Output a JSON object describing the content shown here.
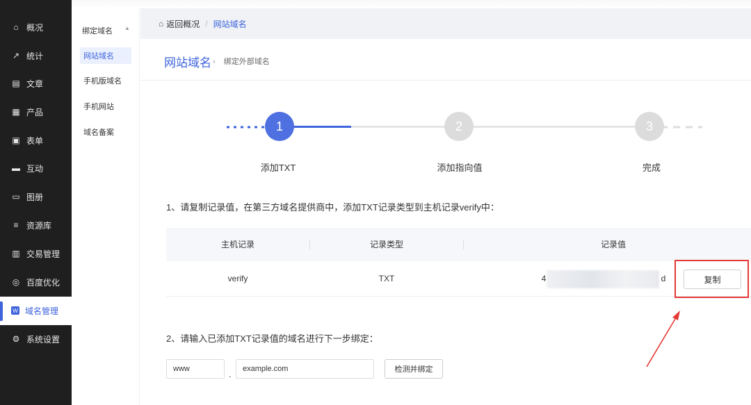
{
  "sidebar": {
    "items": [
      {
        "label": "概况",
        "icon": "home-icon",
        "glyph": "⌂"
      },
      {
        "label": "统计",
        "icon": "stats-icon",
        "glyph": "↗"
      },
      {
        "label": "文章",
        "icon": "article-icon",
        "glyph": "▤"
      },
      {
        "label": "产品",
        "icon": "product-icon",
        "glyph": "▦"
      },
      {
        "label": "表单",
        "icon": "form-icon",
        "glyph": "▣"
      },
      {
        "label": "互动",
        "icon": "chat-icon",
        "glyph": "▬"
      },
      {
        "label": "图册",
        "icon": "album-icon",
        "glyph": "▭"
      },
      {
        "label": "资源库",
        "icon": "database-icon",
        "glyph": "≡"
      },
      {
        "label": "交易管理",
        "icon": "trade-icon",
        "glyph": "▥"
      },
      {
        "label": "百度优化",
        "icon": "seo-icon",
        "glyph": "◎"
      },
      {
        "label": "域名管理",
        "icon": "domain-icon",
        "glyph": "W"
      },
      {
        "label": "系统设置",
        "icon": "gear-icon",
        "glyph": "⚙"
      }
    ]
  },
  "subnav": {
    "group": "绑定域名",
    "items": [
      "网站域名",
      "手机版域名",
      "手机网站",
      "域名备案"
    ]
  },
  "breadcrumb": {
    "back": "返回概况",
    "separator": "/",
    "current": "网站域名"
  },
  "page": {
    "title": "网站域名",
    "subtitle": "绑定外部域名"
  },
  "steps": [
    {
      "number": "1",
      "label": "添加TXT"
    },
    {
      "number": "2",
      "label": "添加指向值"
    },
    {
      "number": "3",
      "label": "完成"
    }
  ],
  "instruction1": "1、请复制记录值，在第三方域名提供商中，添加TXT记录类型到主机记录verify中：",
  "table": {
    "headers": [
      "主机记录",
      "记录类型",
      "记录值"
    ],
    "row": {
      "host": "verify",
      "type": "TXT",
      "value_prefix": "4",
      "value_suffix": "d"
    },
    "copy_label": "复制"
  },
  "instruction2": "2、请输入已添加TXT记录值的域名进行下一步绑定：",
  "form": {
    "prefix_value": "www",
    "dot": ".",
    "domain_value": "example.com",
    "submit_label": "检测并绑定"
  },
  "colors": {
    "accent": "#3d63dd",
    "sidebar_bg": "#1f1f1f",
    "highlight": "#e53935"
  }
}
